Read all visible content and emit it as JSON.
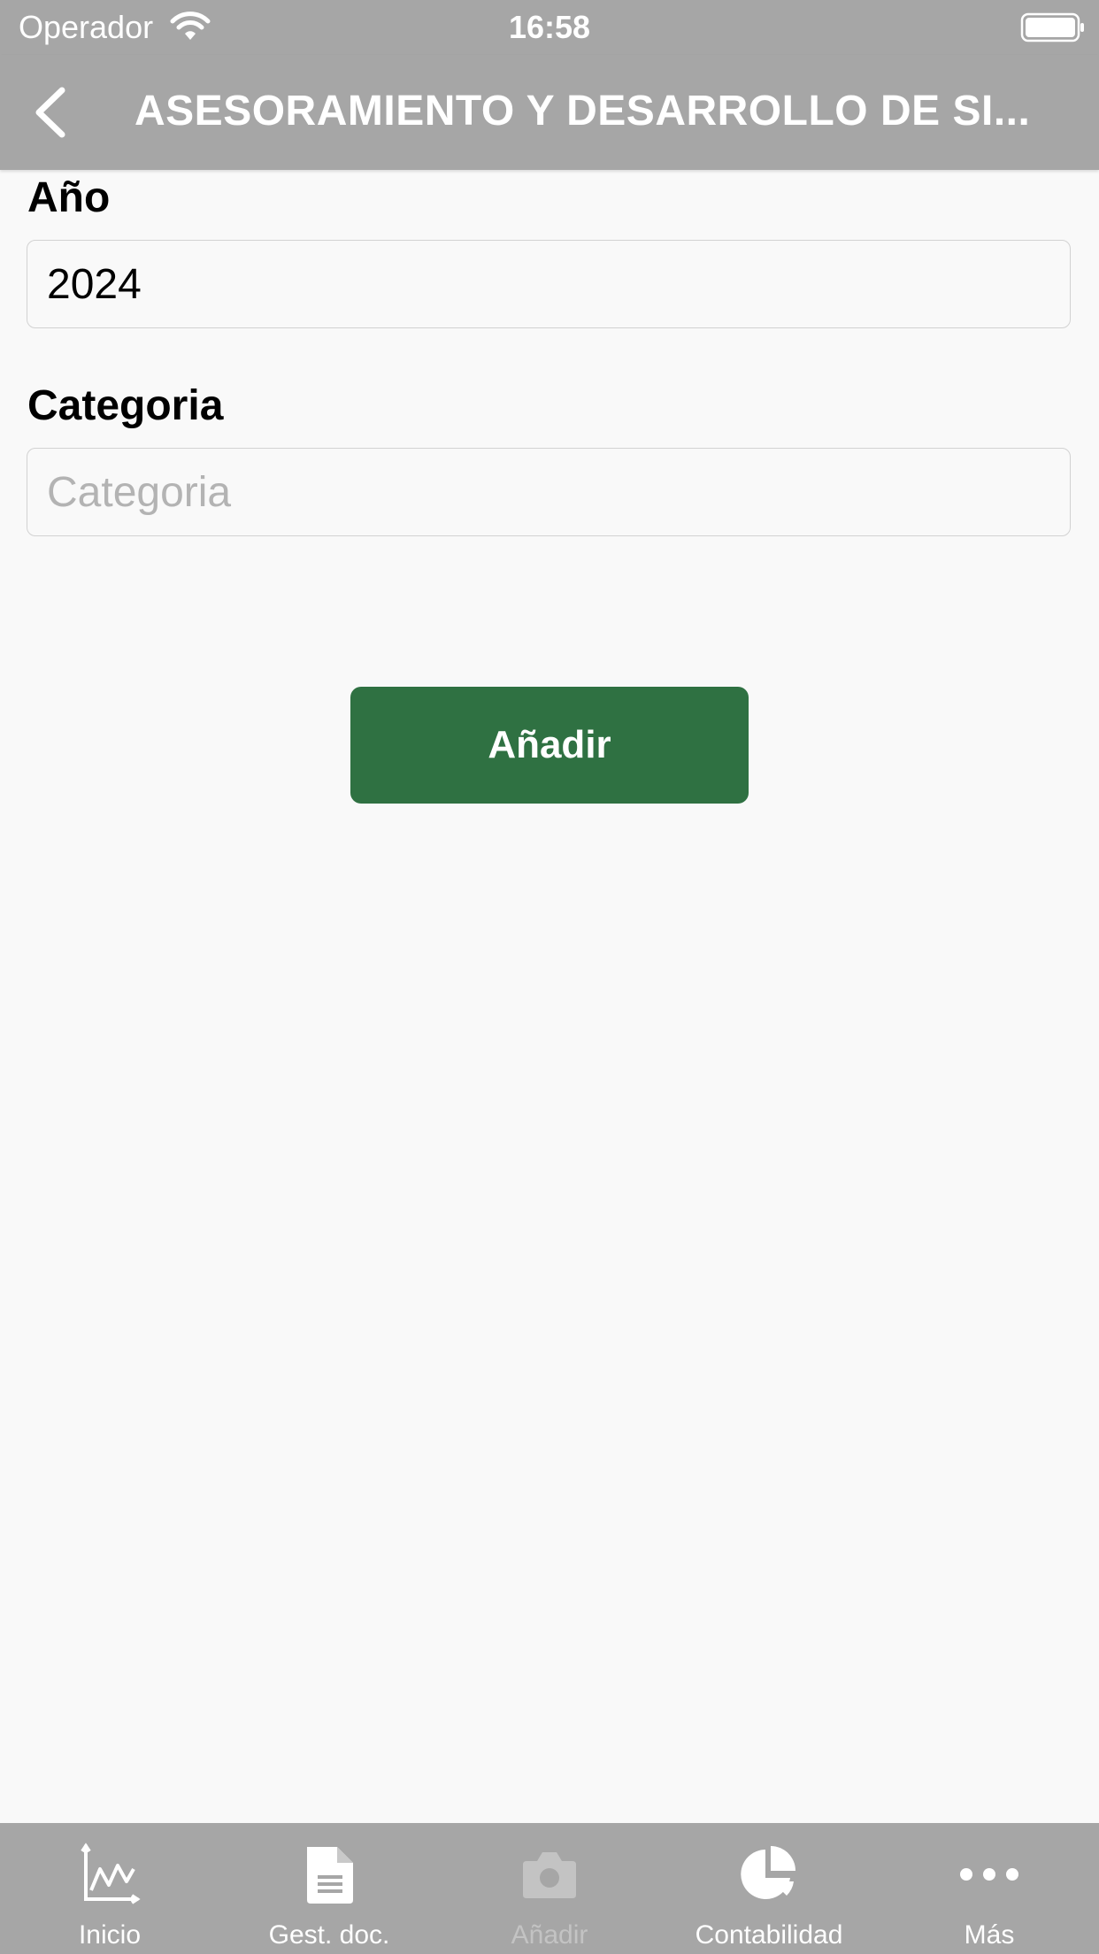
{
  "status_bar": {
    "carrier": "Operador",
    "time": "16:58"
  },
  "nav": {
    "title": "ASESORAMIENTO Y DESARROLLO DE SI..."
  },
  "form": {
    "year_label": "Año",
    "year_value": "2024",
    "category_label": "Categoria",
    "category_placeholder": "Categoria",
    "category_value": ""
  },
  "add_button_label": "Añadir",
  "tabs": [
    {
      "label": "Inicio",
      "icon": "chart-line-icon",
      "enabled": true
    },
    {
      "label": "Gest. doc.",
      "icon": "document-icon",
      "enabled": true
    },
    {
      "label": "Añadir",
      "icon": "camera-icon",
      "enabled": false
    },
    {
      "label": "Contabilidad",
      "icon": "pie-chart-icon",
      "enabled": true
    },
    {
      "label": "Más",
      "icon": "more-icon",
      "enabled": true
    }
  ],
  "colors": {
    "bar_background": "#a6a6a6",
    "accent_green": "#2f7142",
    "page_background": "#f9f9f9"
  }
}
